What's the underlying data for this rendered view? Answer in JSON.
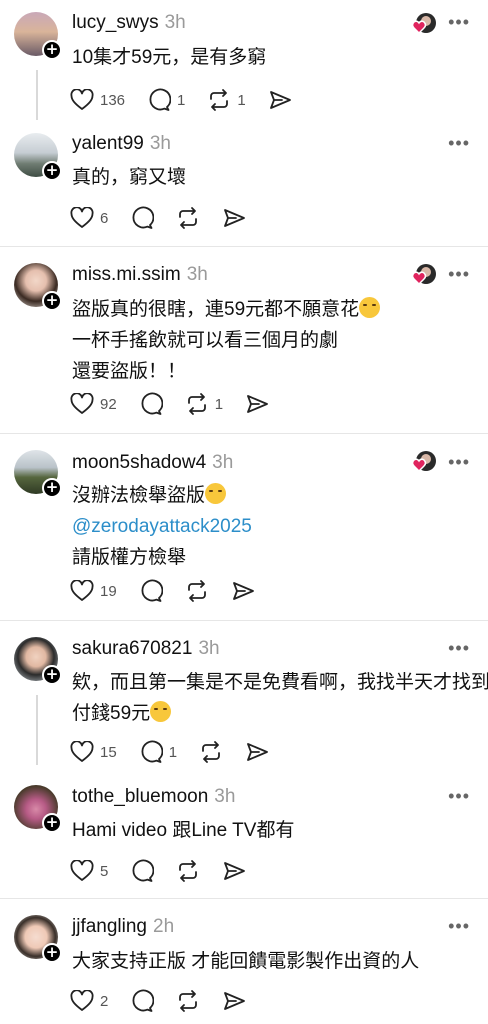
{
  "posts": [
    {
      "username": "lucy_swys",
      "time": "3h",
      "lines": [
        "10集才59元，是有多窮"
      ],
      "likes": "136",
      "replies": "1",
      "reposts": "1",
      "liked_by_author": true
    },
    {
      "username": "yalent99",
      "time": "3h",
      "lines": [
        "真的，窮又壞"
      ],
      "likes": "6",
      "replies": "",
      "reposts": "",
      "liked_by_author": false
    },
    {
      "username": "miss.mi.ssim",
      "time": "3h",
      "lines": [
        "盜版真的很瞎，連59元都不願意花",
        "一杯手搖飲就可以看三個月的劇",
        "還要盜版！！"
      ],
      "likes": "92",
      "replies": "",
      "reposts": "1",
      "liked_by_author": true
    },
    {
      "username": "moon5shadow4",
      "time": "3h",
      "lines": [
        "沒辦法檢舉盜版",
        "@zerodayattack2025",
        "請版權方檢舉"
      ],
      "likes": "19",
      "replies": "",
      "reposts": "",
      "liked_by_author": true
    },
    {
      "username": "sakura670821",
      "time": "3h",
      "lines": [
        "欸，而且第一集是不是免費看啊，我找半天才找到",
        "付錢59元"
      ],
      "likes": "15",
      "replies": "1",
      "reposts": "",
      "liked_by_author": false
    },
    {
      "username": "tothe_bluemoon",
      "time": "3h",
      "lines": [
        "Hami video 跟Line TV都有"
      ],
      "likes": "5",
      "replies": "",
      "reposts": "",
      "liked_by_author": false
    },
    {
      "username": "jjfangling",
      "time": "2h",
      "lines": [
        "大家支持正版 才能回饋電影製作出資的人"
      ],
      "likes": "2",
      "replies": "",
      "reposts": "",
      "liked_by_author": false
    }
  ],
  "icons": {
    "like": "heart-icon",
    "reply": "comment-icon",
    "repost": "repost-icon",
    "share": "share-icon",
    "more": "more-icon",
    "follow": "plus-icon"
  },
  "more_label": "•••",
  "follow_label": "+",
  "colors": {
    "mention": "#2c8ec9",
    "time": "#9a9a9a",
    "heart_badge": "#e0245e"
  }
}
